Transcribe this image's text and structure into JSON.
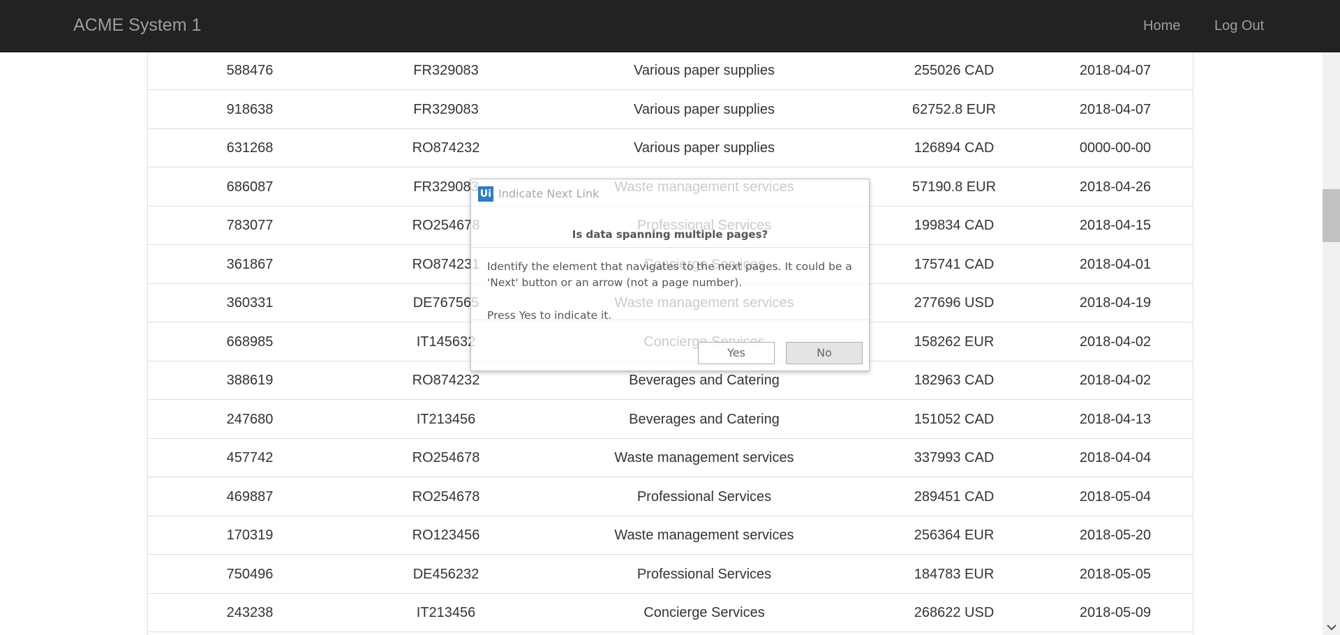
{
  "header": {
    "brand": "ACME System 1",
    "nav": [
      {
        "label": "Home"
      },
      {
        "label": "Log Out"
      }
    ]
  },
  "table": {
    "rows": [
      [
        "588476",
        "FR329083",
        "Various paper supplies",
        "255026 CAD",
        "2018-04-07"
      ],
      [
        "918638",
        "FR329083",
        "Various paper supplies",
        "62752.8 EUR",
        "2018-04-07"
      ],
      [
        "631268",
        "RO874232",
        "Various paper supplies",
        "126894 CAD",
        "0000-00-00"
      ],
      [
        "686087",
        "FR329083",
        "Waste management services",
        "57190.8 EUR",
        "2018-04-26"
      ],
      [
        "783077",
        "RO254678",
        "Professional Services",
        "199834 CAD",
        "2018-04-15"
      ],
      [
        "361867",
        "RO874231",
        "Concierge Services",
        "175741 CAD",
        "2018-04-01"
      ],
      [
        "360331",
        "DE767565",
        "Waste management services",
        "277696 USD",
        "2018-04-19"
      ],
      [
        "668985",
        "IT145632",
        "Concierge Services",
        "158262 EUR",
        "2018-04-02"
      ],
      [
        "388619",
        "RO874232",
        "Beverages and Catering",
        "182963 CAD",
        "2018-04-02"
      ],
      [
        "247680",
        "IT213456",
        "Beverages and Catering",
        "151052 CAD",
        "2018-04-13"
      ],
      [
        "457742",
        "RO254678",
        "Waste management services",
        "337993 CAD",
        "2018-04-04"
      ],
      [
        "469887",
        "RO254678",
        "Professional Services",
        "289451 CAD",
        "2018-05-04"
      ],
      [
        "170319",
        "RO123456",
        "Waste management services",
        "256364 EUR",
        "2018-05-20"
      ],
      [
        "750496",
        "DE456232",
        "Professional Services",
        "184783 EUR",
        "2018-05-05"
      ],
      [
        "243238",
        "IT213456",
        "Concierge Services",
        "268622 USD",
        "2018-05-09"
      ]
    ]
  },
  "dialog": {
    "icon_text": "Ui",
    "title": "Indicate Next Link",
    "question": "Is data spanning multiple pages?",
    "body": "Identify the element that navigates to the next pages. It could be a 'Next' button or an arrow (not a page number).",
    "press": "Press Yes to indicate it.",
    "yes_label": "Yes",
    "no_label": "No"
  },
  "colors": {
    "navbar_bg": "#222222",
    "navbar_text": "#9d9d9d",
    "accent": "#2f7cc1"
  }
}
